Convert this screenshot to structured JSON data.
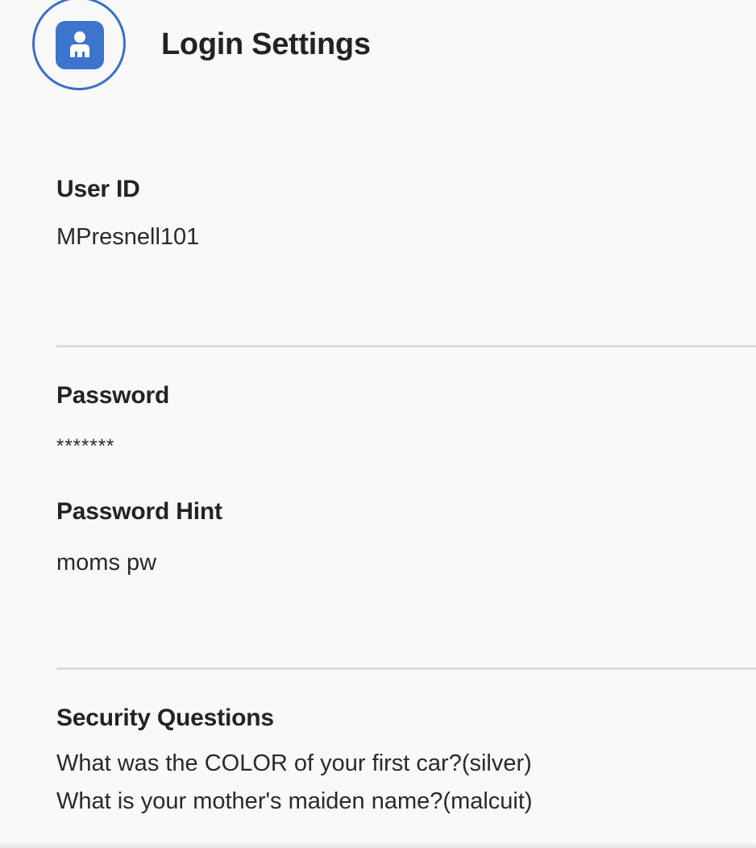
{
  "header": {
    "title": "Login Settings",
    "avatar_icon": "user-icon",
    "accent_color": "#3d74cc"
  },
  "user_id": {
    "label": "User ID",
    "value": "MPresnell101"
  },
  "password": {
    "label": "Password",
    "value": "*******"
  },
  "password_hint": {
    "label": "Password Hint",
    "value": "moms pw"
  },
  "security_questions": {
    "label": "Security Questions",
    "items": [
      "What was the COLOR of your first car?(silver)",
      "What is your mother's maiden name?(malcuit)"
    ]
  }
}
